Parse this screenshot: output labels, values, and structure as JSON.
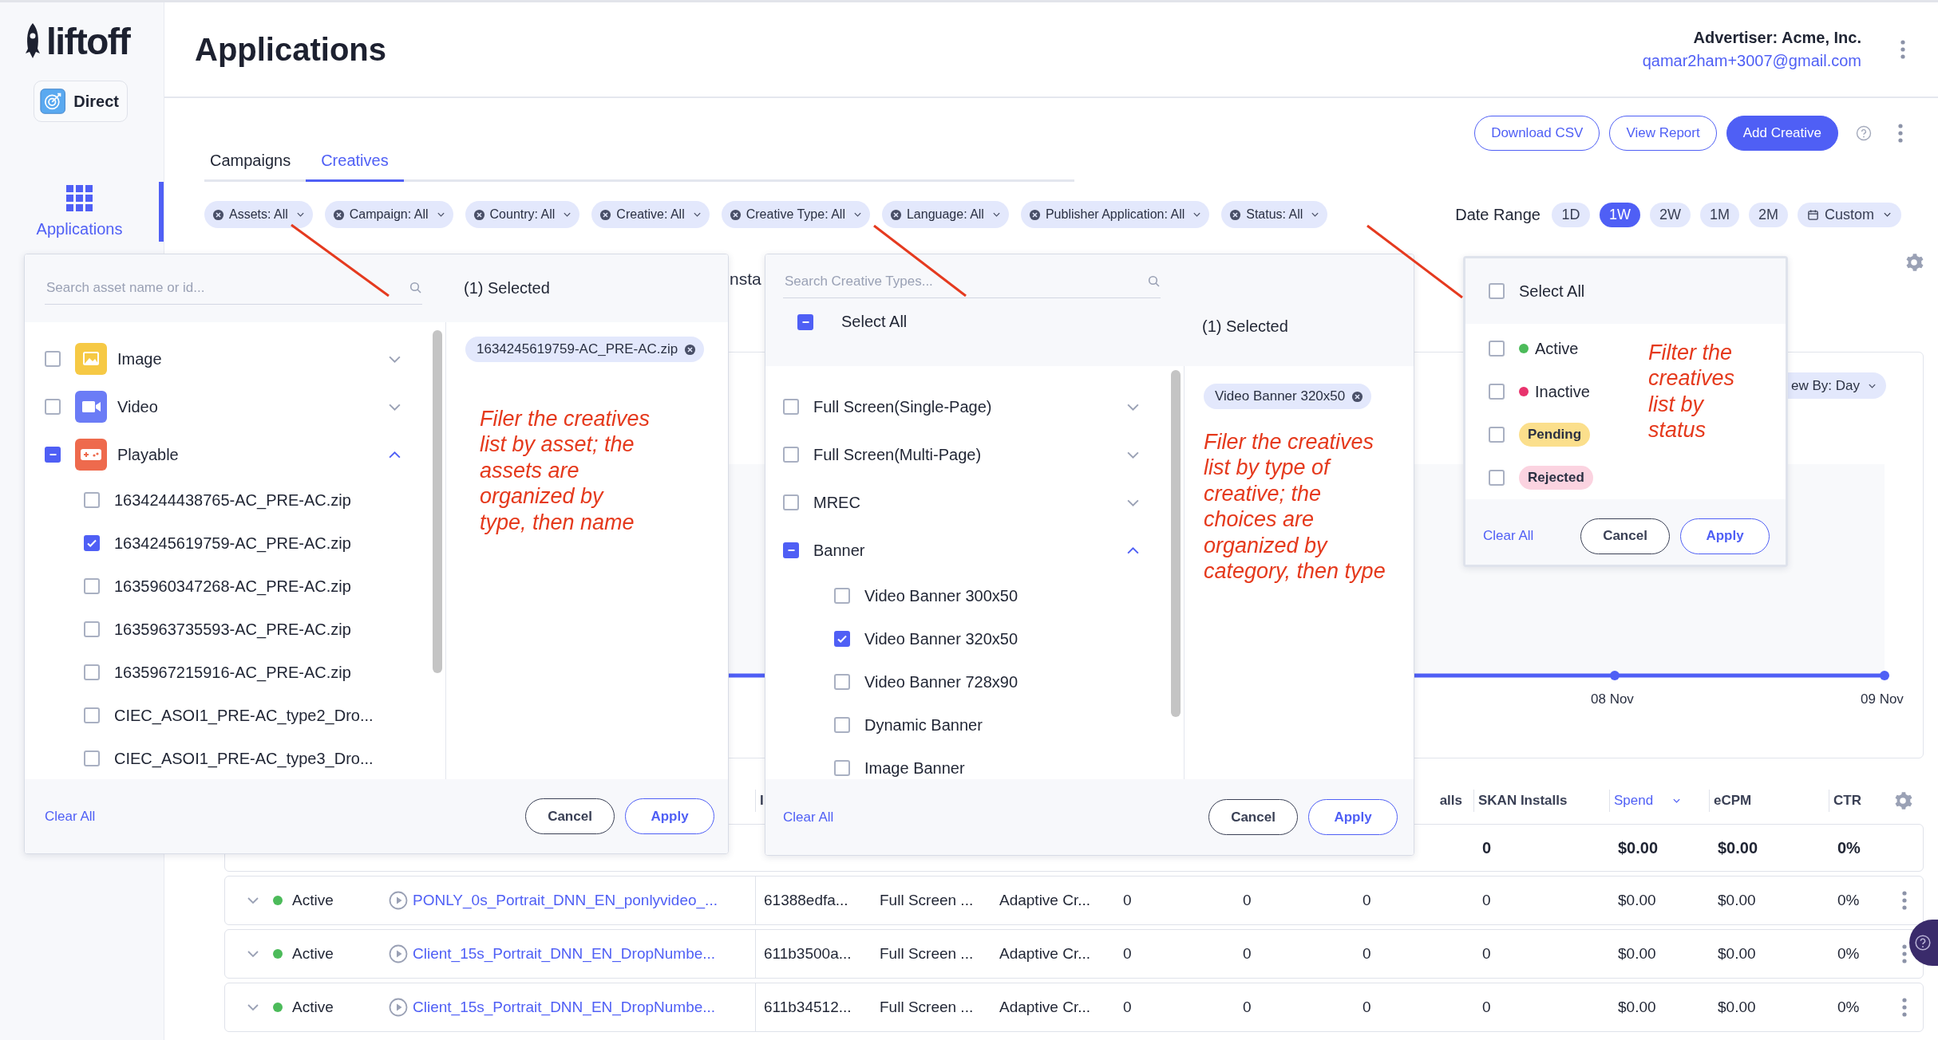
{
  "sidebar": {
    "logo": "liftoff",
    "account_button": "Direct",
    "nav": [
      {
        "label": "Applications",
        "selected": true
      }
    ]
  },
  "header": {
    "title": "Applications",
    "advertiser": "Advertiser: Acme, Inc.",
    "email": "qamar2ham+3007@gmail.com"
  },
  "tabs": [
    {
      "label": "Campaigns",
      "selected": false
    },
    {
      "label": "Creatives",
      "selected": true
    }
  ],
  "actions": [
    {
      "label": "Download CSV",
      "kind": "outline"
    },
    {
      "label": "View Report",
      "kind": "outline"
    },
    {
      "label": "Add Creative",
      "kind": "primary"
    }
  ],
  "filters": [
    {
      "label": "Assets: All"
    },
    {
      "label": "Campaign: All"
    },
    {
      "label": "Country: All"
    },
    {
      "label": "Creative: All"
    },
    {
      "label": "Creative Type: All"
    },
    {
      "label": "Language: All"
    },
    {
      "label": "Publisher Application: All"
    },
    {
      "label": "Status: All"
    }
  ],
  "date_range": {
    "label": "Date Range",
    "options": [
      {
        "label": "1D",
        "selected": false,
        "kind": "pill"
      },
      {
        "label": "1W",
        "selected": true,
        "kind": "pill"
      },
      {
        "label": "2W",
        "selected": false,
        "kind": "pill"
      },
      {
        "label": "1M",
        "selected": false,
        "kind": "pill"
      },
      {
        "label": "2M",
        "selected": false,
        "kind": "pill"
      },
      {
        "label": "Custom",
        "selected": false,
        "kind": "dropdown"
      }
    ]
  },
  "metrics": {
    "tab": "nsta"
  },
  "chart": {
    "view_by": "ew By: Day",
    "x_labels": [
      "08 Nov",
      "09 Nov"
    ]
  },
  "table": {
    "columns": [
      {
        "label": "I",
        "sorted": false
      },
      {
        "label": "alls",
        "sorted": false
      },
      {
        "label": "SKAN Installs",
        "sorted": false
      },
      {
        "label": "Spend",
        "sorted": true
      },
      {
        "label": "eCPM",
        "sorted": false
      },
      {
        "label": "CTR",
        "sorted": false
      }
    ],
    "total": [
      "0",
      "$0.00",
      "$0.00",
      "0%"
    ],
    "rows": [
      {
        "status": "Active",
        "name": "PONLY_0s_Portrait_DNN_EN_ponlyvideo_...",
        "id": "61388edfa...",
        "type": "Full Screen ...",
        "template": "Adaptive Cr...",
        "values": [
          "0",
          "0",
          "0",
          "0",
          "$0.00",
          "$0.00",
          "0%"
        ]
      },
      {
        "status": "Active",
        "name": "Client_15s_Portrait_DNN_EN_DropNumbe...",
        "id": "611b3500a...",
        "type": "Full Screen ...",
        "template": "Adaptive Cr...",
        "values": [
          "0",
          "0",
          "0",
          "0",
          "$0.00",
          "$0.00",
          "0%"
        ]
      },
      {
        "status": "Active",
        "name": "Client_15s_Portrait_DNN_EN_DropNumbe...",
        "id": "611b34512...",
        "type": "Full Screen ...",
        "template": "Adaptive Cr...",
        "values": [
          "0",
          "0",
          "0",
          "0",
          "$0.00",
          "$0.00",
          "0%"
        ]
      }
    ]
  },
  "asset_filter": {
    "placeholder": "Search asset name or id...",
    "groups": [
      {
        "label": "Image",
        "kind": "image",
        "partial": false,
        "expanded": false
      },
      {
        "label": "Video",
        "kind": "video",
        "partial": false,
        "expanded": false
      },
      {
        "label": "Playable",
        "kind": "playable",
        "partial": true,
        "expanded": true,
        "children": [
          {
            "label": "1634244438765-AC_PRE-AC.zip",
            "checked": false
          },
          {
            "label": "1634245619759-AC_PRE-AC.zip",
            "checked": true
          },
          {
            "label": "1635960347268-AC_PRE-AC.zip",
            "checked": false
          },
          {
            "label": "1635963735593-AC_PRE-AC.zip",
            "checked": false
          },
          {
            "label": "1635967215916-AC_PRE-AC.zip",
            "checked": false
          },
          {
            "label": "CIEC_ASOI1_PRE-AC_type2_Dro...",
            "checked": false
          },
          {
            "label": "CIEC_ASOI1_PRE-AC_type3_Dro...",
            "checked": false
          }
        ]
      }
    ],
    "selected_title": "(1) Selected",
    "selected_chips": [
      "1634245619759-AC_PRE-AC.zip"
    ],
    "note": "Filer the creatives list by asset; the assets are organized by type, then name",
    "clear": "Clear All",
    "cancel": "Cancel",
    "apply": "Apply"
  },
  "type_filter": {
    "placeholder": "Search Creative Types...",
    "select_all": {
      "label": "Select All",
      "partial": true
    },
    "groups": [
      {
        "label": "Full Screen(Single-Page)",
        "partial": false,
        "expanded": false
      },
      {
        "label": "Full Screen(Multi-Page)",
        "partial": false,
        "expanded": false
      },
      {
        "label": "MREC",
        "partial": false,
        "expanded": false
      },
      {
        "label": "Banner",
        "partial": true,
        "expanded": true,
        "children": [
          {
            "label": "Video Banner 300x50",
            "checked": false
          },
          {
            "label": "Video Banner 320x50",
            "checked": true
          },
          {
            "label": "Video Banner 728x90",
            "checked": false
          },
          {
            "label": "Dynamic Banner",
            "checked": false
          },
          {
            "label": "Image Banner",
            "checked": false
          }
        ]
      }
    ],
    "selected_title": "(1) Selected",
    "selected_chips": [
      "Video Banner 320x50"
    ],
    "note": "Filer the creatives list by type of creative; the choices are organized by category, then type",
    "clear": "Clear All",
    "cancel": "Cancel",
    "apply": "Apply"
  },
  "status_filter": {
    "select_all": {
      "label": "Select All",
      "checked": false
    },
    "items": [
      {
        "label": "Active",
        "kind": "dot",
        "color": "#4cbb5a",
        "checked": false
      },
      {
        "label": "Inactive",
        "kind": "dot",
        "color": "#e8336d",
        "checked": false
      },
      {
        "label": "Pending",
        "kind": "badge",
        "color": "#fbdf8c",
        "checked": false
      },
      {
        "label": "Rejected",
        "kind": "badge",
        "color": "#fbd3e0",
        "checked": false
      }
    ],
    "note": "Filter the creatives list by status",
    "clear": "Clear All",
    "cancel": "Cancel",
    "apply": "Apply"
  }
}
